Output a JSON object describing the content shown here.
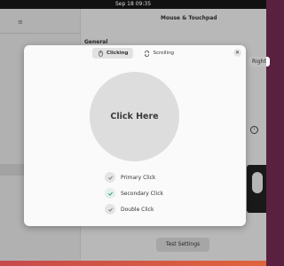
{
  "system": {
    "clock": "Sep 18  09:35"
  },
  "window": {
    "title": "Mouse & Touchpad",
    "section": "General",
    "right_chip": "Right",
    "test_button": "Test Settings"
  },
  "dialog": {
    "tabs": [
      {
        "label": "Clicking",
        "icon": "mouse-icon",
        "active": true
      },
      {
        "label": "Scrolling",
        "icon": "scroll-icon",
        "active": false
      }
    ],
    "click_area": "Click Here",
    "checks": [
      {
        "label": "Primary Click",
        "done": false
      },
      {
        "label": "Secondary Click",
        "done": true
      },
      {
        "label": "Double Click",
        "done": false
      }
    ]
  },
  "colors": {
    "accent_done": "#2a9a6a",
    "pending": "#777777"
  }
}
